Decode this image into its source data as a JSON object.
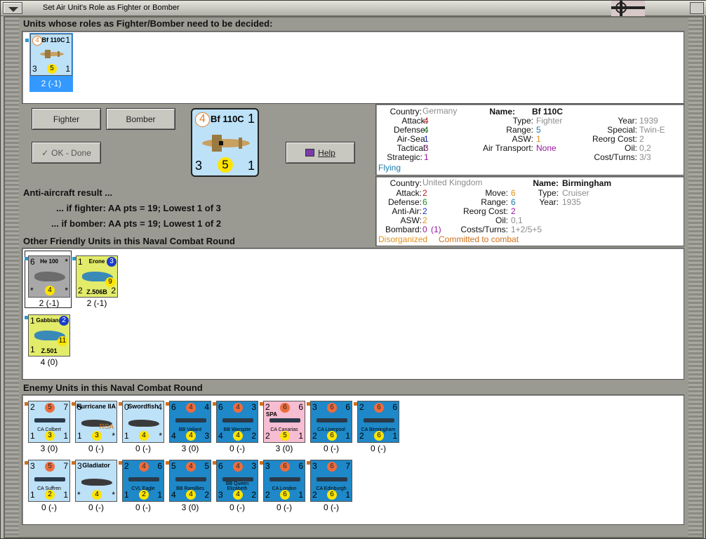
{
  "window": {
    "title": "Set Air Unit's Role as Fighter or Bomber",
    "colors": {
      "frame": "#b9b9b1",
      "panel": "#ffffff",
      "selected": "#3399ff",
      "allied_air": "#bde1f7",
      "italian": "#e2ec6a",
      "navy": "#1e88c8",
      "french": "#f7bdd2"
    }
  },
  "sections": {
    "undecided_heading": "Units whose roles as Fighter/Bomber need to be decided:",
    "aa_heading": "Anti-aircraft result ...",
    "aa_fighter": "... if fighter:  AA pts = 19; Lowest 1 of 3",
    "aa_bomber": "... if bomber:  AA pts = 19; Lowest 1 of 2",
    "friendly_heading": "Other Friendly Units in this Naval Combat Round",
    "enemy_heading": "Enemy Units in this Naval Combat Round"
  },
  "buttons": {
    "fighter": "Fighter",
    "bomber": "Bomber",
    "ok_done": "OK - Done",
    "help": "Help"
  },
  "undecided_unit": {
    "name": "Bf 110C",
    "top_left": "4",
    "top_right": "1",
    "bottom_left": "3",
    "center": "5",
    "bottom_right": "1",
    "strength": "2 (-1)"
  },
  "large_unit": {
    "name": "Bf 110C",
    "top_left": "4",
    "top_right": "1",
    "bottom_left": "3",
    "center": "5",
    "bottom_right": "1"
  },
  "info_air": {
    "labels": {
      "country": "Country:",
      "attack": "Attack:",
      "defense": "Defense:",
      "air_sea": "Air-Sea:",
      "tactical": "Tactical:",
      "strategic": "Strategic:",
      "name": "Name:",
      "type": "Type:",
      "range": "Range:",
      "asw": "ASW:",
      "air_transport": "Air Transport:",
      "year": "Year:",
      "special": "Special:",
      "reorg": "Reorg Cost:",
      "oil": "Oil:",
      "cost_turns": "Cost/Turns:"
    },
    "country": "Germany",
    "attack": "4",
    "defense": "4",
    "air_sea": "1",
    "tactical": "3",
    "strategic": "1",
    "name": "Bf 110C",
    "type": "Fighter",
    "range": "5",
    "asw": "1",
    "air_transport": "None",
    "year": "1939",
    "special": "Twin-E",
    "reorg": "2",
    "oil": "0,2",
    "cost_turns": "3/3",
    "status": "Flying"
  },
  "info_naval": {
    "labels": {
      "country": "Country:",
      "attack": "Attack:",
      "defense": "Defense:",
      "anti_air": "Anti-Air:",
      "asw": "ASW:",
      "bombard": "Bombard:",
      "move": "Move:",
      "range": "Range:",
      "reorg": "Reorg Cost:",
      "oil": "Oil:",
      "costs_turns": "Costs/Turns:",
      "name": "Name:",
      "type": "Type:",
      "year": "Year:"
    },
    "country": "United Kingdom",
    "attack": "2",
    "defense": "6",
    "anti_air": "2",
    "asw": "2",
    "bombard_a": "0",
    "bombard_b": "(1)",
    "move": "6",
    "range": "6",
    "reorg": "2",
    "oil": "0,1",
    "costs_turns": "1+2/5+5",
    "name": "Birmingham",
    "type": "Cruiser",
    "year": "1935",
    "status_a": "Disorganized",
    "status_b": "Committed to combat"
  },
  "friendly_units": [
    {
      "name": "He 100",
      "top_left": "6",
      "top_right": "*",
      "bottom_left": "*",
      "center": "4",
      "bottom_right": "*",
      "strength": "2 (-1)",
      "color": "#a8a8a8"
    },
    {
      "name": "Erone",
      "sub": "Z.506B",
      "top_left": "1",
      "top_right": "3",
      "bottom_left": "2",
      "center": "9",
      "bottom_right": "2",
      "strength": "2 (-1)",
      "color": "#e2ec6a"
    },
    {
      "name": "Gabbiano",
      "sub": "Z.501",
      "top_left": "1",
      "top_right": "2",
      "bottom_left": "1",
      "center": "11",
      "bottom_right": "",
      "strength": "4 (0)",
      "color": "#e2ec6a"
    }
  ],
  "enemy_row1": [
    {
      "name": "CA Colbert",
      "top_left": "2",
      "top_mid": "5",
      "top_right": "7",
      "bottom_left": "1",
      "center": "3",
      "bottom_right": "1",
      "strength": "3 (0)"
    },
    {
      "name": "Hurricane IIA",
      "sub": "RSA",
      "top_left": "5",
      "top_mid": "",
      "top_right": "",
      "bottom_left": "1",
      "center": "3",
      "bottom_right": "*",
      "strength": "0 (-)"
    },
    {
      "name": "Swordfish",
      "top_left": "0",
      "top_mid": "",
      "top_right": "4",
      "bottom_left": "1",
      "center": "4",
      "bottom_right": "*",
      "strength": "0 (-)"
    },
    {
      "name": "BB Valiant",
      "top_left": "6",
      "top_mid": "4",
      "top_right": "4",
      "bottom_left": "4",
      "center": "4",
      "bottom_right": "3",
      "strength": "3 (0)"
    },
    {
      "name": "BB Warspite",
      "top_left": "6",
      "top_mid": "4",
      "top_right": "3",
      "bottom_left": "4",
      "center": "4",
      "bottom_right": "2",
      "strength": "0 (-)"
    },
    {
      "name": "CA Canarias",
      "top_left": "2",
      "top_mid": "6",
      "top_right": "6",
      "bottom_left": "2",
      "center": "5",
      "bottom_right": "1",
      "strength": "3 (0)",
      "flag": "SPA"
    },
    {
      "name": "CA Liverpool",
      "top_left": "3",
      "top_mid": "6",
      "top_right": "6",
      "bottom_left": "2",
      "center": "6",
      "bottom_right": "1",
      "strength": "0 (-)"
    },
    {
      "name": "CA Birmingham",
      "top_left": "2",
      "top_mid": "6",
      "top_right": "6",
      "bottom_left": "2",
      "center": "6",
      "bottom_right": "1",
      "strength": "0 (-)"
    }
  ],
  "enemy_row2": [
    {
      "name": "CA Suffren",
      "top_left": "3",
      "top_mid": "5",
      "top_right": "7",
      "bottom_left": "1",
      "center": "2",
      "bottom_right": "1",
      "strength": "0 (-)"
    },
    {
      "name": "Gladiator",
      "top_left": "3",
      "top_mid": "",
      "top_right": "",
      "bottom_left": "*",
      "center": "4",
      "bottom_right": "*",
      "strength": "0 (-)"
    },
    {
      "name": "CVL Eagle",
      "top_left": "2",
      "top_mid": "4",
      "top_right": "6",
      "bottom_left": "1",
      "center": "2",
      "bottom_right": "1",
      "strength": "0 (-)"
    },
    {
      "name": "BB Ramillies",
      "top_left": "5",
      "top_mid": "4",
      "top_right": "5",
      "bottom_left": "4",
      "center": "4",
      "bottom_right": "2",
      "strength": "3 (0)"
    },
    {
      "name": "BB Queen Elizabeth",
      "top_left": "6",
      "top_mid": "4",
      "top_right": "3",
      "bottom_left": "3",
      "center": "4",
      "bottom_right": "2",
      "strength": "0 (-)"
    },
    {
      "name": "CA London",
      "top_left": "3",
      "top_mid": "6",
      "top_right": "6",
      "bottom_left": "2",
      "center": "6",
      "bottom_right": "1",
      "strength": "0 (-)"
    },
    {
      "name": "CA Edinburgh",
      "top_left": "3",
      "top_mid": "6",
      "top_right": "7",
      "bottom_left": "2",
      "center": "6",
      "bottom_right": "1",
      "strength": "0 (-)"
    }
  ]
}
